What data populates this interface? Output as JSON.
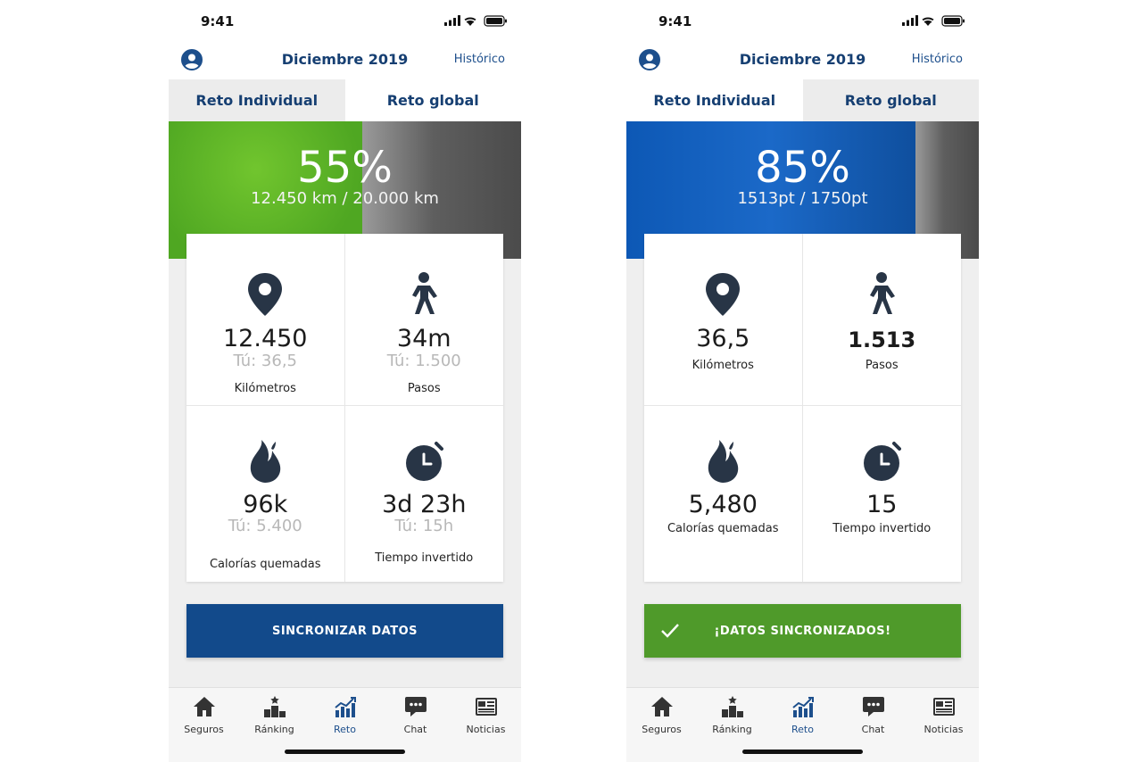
{
  "screens": [
    {
      "status_time": "9:41",
      "header": {
        "title": "Diciembre 2019",
        "history_link": "Histórico"
      },
      "tabs": [
        {
          "label": "Reto Individual",
          "selected": false
        },
        {
          "label": "Reto global",
          "selected": true
        }
      ],
      "progress": {
        "percent_label": "55%",
        "percent": 55,
        "detail": "12.450 km / 20.000 km",
        "fill_color": "#5cb52a"
      },
      "stats": [
        {
          "icon": "location-pin-icon",
          "value": "12.450",
          "you": "Tú: 36,5",
          "label": "Kilómetros"
        },
        {
          "icon": "walking-person-icon",
          "value": "34m",
          "you": "Tú: 1.500",
          "label": "Pasos"
        },
        {
          "icon": "flame-icon",
          "value": "96k",
          "you": "Tú: 5.400",
          "label": "Calorías quemadas"
        },
        {
          "icon": "stopwatch-icon",
          "value": "3d 23h",
          "you": "Tú: 15h",
          "label": "Tiempo invertido"
        }
      ],
      "sync_button": {
        "label": "SINCRONIZAR DATOS",
        "color": "#124a8b"
      },
      "tabbar": [
        {
          "icon": "home-icon",
          "label": "Seguros",
          "active": false
        },
        {
          "icon": "podium-icon",
          "label": "Ránking",
          "active": false
        },
        {
          "icon": "chart-trend-icon",
          "label": "Reto",
          "active": true
        },
        {
          "icon": "chat-icon",
          "label": "Chat",
          "active": false
        },
        {
          "icon": "newspaper-icon",
          "label": "Noticias",
          "active": false
        }
      ]
    },
    {
      "status_time": "9:41",
      "header": {
        "title": "Diciembre 2019",
        "history_link": "Histórico"
      },
      "tabs": [
        {
          "label": "Reto Individual",
          "selected": true
        },
        {
          "label": "Reto global",
          "selected": false
        }
      ],
      "progress": {
        "percent_label": "85%",
        "percent": 82,
        "detail": "1513pt / 1750pt",
        "fill_color": "#1563c0"
      },
      "stats": [
        {
          "icon": "location-pin-icon",
          "value": "36,5",
          "label": "Kilómetros"
        },
        {
          "icon": "walking-person-icon",
          "value": "1.513",
          "label": "Pasos"
        },
        {
          "icon": "flame-icon",
          "value": "5,480",
          "label": "Calorías quemadas"
        },
        {
          "icon": "stopwatch-icon",
          "value": "15",
          "label": "Tiempo invertido"
        }
      ],
      "sync_button": {
        "label": "¡DATOS SINCRONIZADOS!",
        "color": "#4f9a2a"
      },
      "tabbar": [
        {
          "icon": "home-icon",
          "label": "Seguros",
          "active": false
        },
        {
          "icon": "podium-icon",
          "label": "Ránking",
          "active": false
        },
        {
          "icon": "chart-trend-icon",
          "label": "Reto",
          "active": true
        },
        {
          "icon": "chat-icon",
          "label": "Chat",
          "active": false
        },
        {
          "icon": "newspaper-icon",
          "label": "Noticias",
          "active": false
        }
      ]
    }
  ]
}
